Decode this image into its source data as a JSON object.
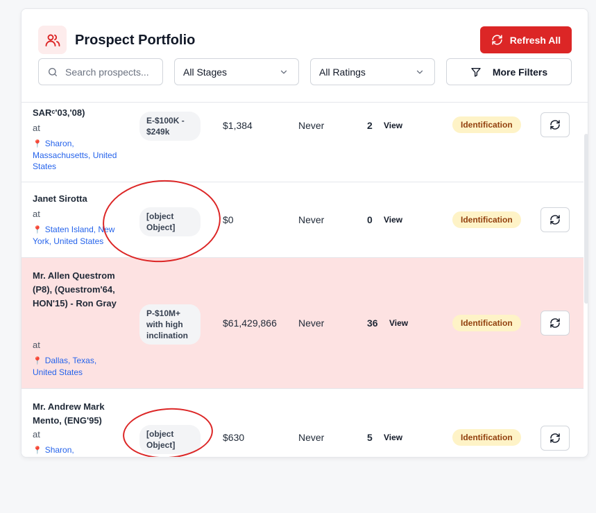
{
  "header": {
    "title": "Prospect Portfolio",
    "refresh_all_label": "Refresh All",
    "search_placeholder": "Search prospects...",
    "stage_select": "All Stages",
    "rating_select": "All Ratings",
    "more_filters_label": "More Filters"
  },
  "colors": {
    "accent": "#dc2626",
    "highlight_row": "#fde2e2",
    "stage_badge": "#fef3c7",
    "location_link": "#2563eb"
  },
  "rows": [
    {
      "name": "SARᶜ'03,'08)",
      "at": "at",
      "location": "Sharon, Massachusetts, United States",
      "rating": "E-$100K - $249k",
      "amount": "$1,384",
      "last": "Never",
      "count": "2",
      "view": "View",
      "stage": "Identification"
    },
    {
      "name": "Janet Sirotta",
      "at": "at",
      "location": "Staten Island, New York, United States",
      "rating": "[object Object]",
      "amount": "$0",
      "last": "Never",
      "count": "0",
      "view": "View",
      "stage": "Identification"
    },
    {
      "name": "Mr. Allen Questrom (P8), (Questrom'64, HON'15) - Ron Gray",
      "at": "at",
      "location": "Dallas, Texas, United States",
      "rating": "P-$10M+ with high inclination",
      "amount": "$61,429,866",
      "last": "Never",
      "count": "36",
      "view": "View",
      "stage": "Identification"
    },
    {
      "name": "Mr. Andrew Mark Mento, (ENG'95)",
      "at": "at",
      "location": "Sharon,",
      "rating": "[object Object]",
      "amount": "$630",
      "last": "Never",
      "count": "5",
      "view": "View",
      "stage": "Identification"
    }
  ]
}
